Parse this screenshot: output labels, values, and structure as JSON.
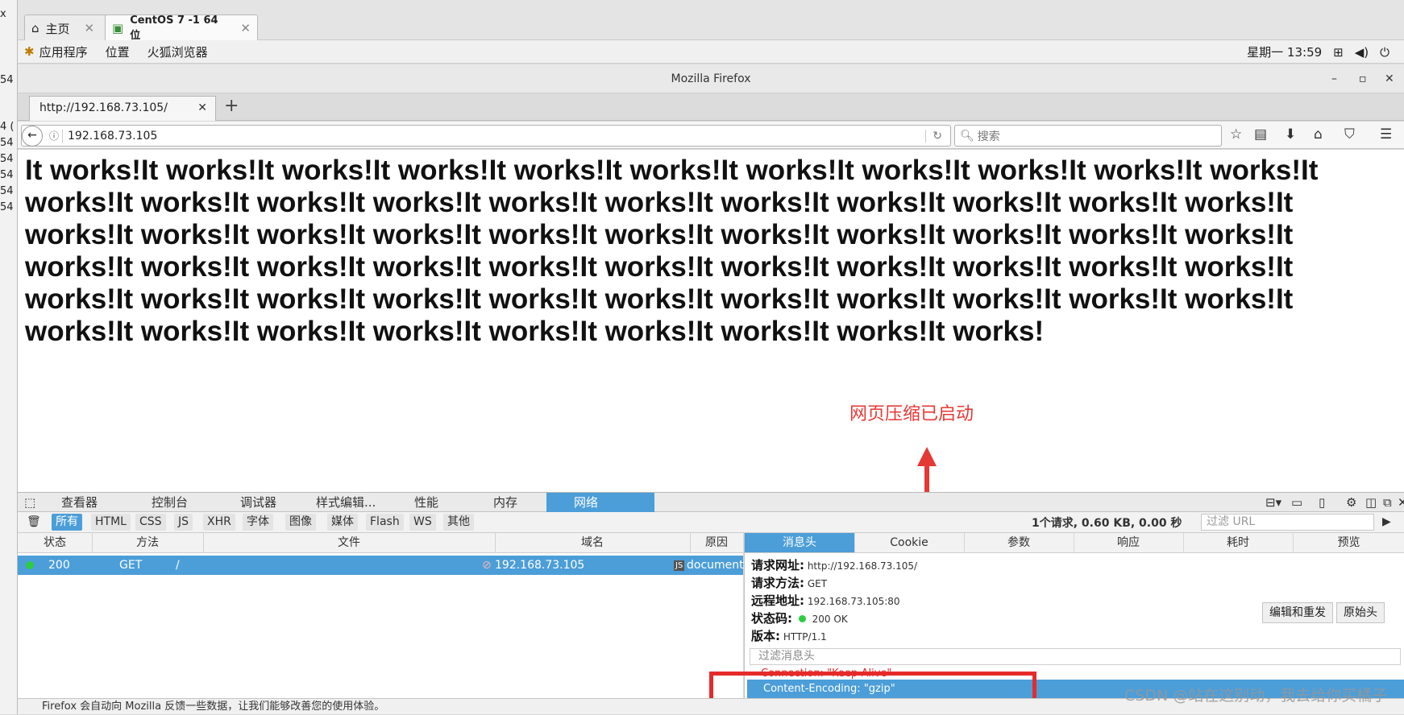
{
  "vm_tabs": [
    {
      "label": "主页",
      "icon": "home-icon"
    },
    {
      "label": "CentOS 7 -1 64 位",
      "icon": "vm-icon"
    }
  ],
  "left_strip": {
    "chars": [
      "x",
      "54",
      "4 (",
      "54",
      "54",
      "54",
      "54",
      "54"
    ]
  },
  "gnome_bar": {
    "menus": [
      "应用程序",
      "位置",
      "火狐浏览器"
    ],
    "clock": "星期一 13:59"
  },
  "window": {
    "title": "Mozilla Firefox"
  },
  "browser_tab": {
    "label": "http://192.168.73.105/"
  },
  "navbar": {
    "url": "192.168.73.105",
    "search_placeholder": "搜索"
  },
  "content": {
    "text": "It works!It works!It works!It works!It works!It works!It works!It works!It works!It works!It works!It works!It works!It works!It works!It works!It works!It works!It works!It works!It works!It works!It works!It works!It works!It works!It works!It works!It works!It works!It works!It works!It works!It works!It works!It works!It works!It works!It works!It works!It works!It works!It works!It works!It works!It works!It works!It works!It works!It works!It works!It works!It works!It works!It works!It works!It works!It works!It works!It works!It works!It works!It works!It works!",
    "annotation": "网页压缩已启动"
  },
  "devtools": {
    "tabs": [
      "查看器",
      "控制台",
      "调试器",
      "样式编辑...",
      "性能",
      "内存",
      "网络"
    ],
    "filters": [
      "所有",
      "HTML",
      "CSS",
      "JS",
      "XHR",
      "字体",
      "图像",
      "媒体",
      "Flash",
      "WS",
      "其他"
    ],
    "summary": "1个请求, 0.60 KB, 0.00 秒",
    "filter_url_placeholder": "过滤 URL",
    "columns": [
      "状态",
      "方法",
      "文件",
      "域名",
      "原因"
    ],
    "request": {
      "status": "200",
      "method": "GET",
      "file": "/",
      "domain": "192.168.73.105",
      "cause": "document",
      "cause_badge": "JS"
    },
    "side_tabs": [
      "消息头",
      "Cookie",
      "参数",
      "响应",
      "耗时",
      "预览"
    ],
    "details": {
      "url_label": "请求网址:",
      "url": "http://192.168.73.105/",
      "method_label": "请求方法:",
      "method": "GET",
      "remote_label": "远程地址:",
      "remote": "192.168.73.105:80",
      "status_label": "状态码:",
      "status": "200  OK",
      "version_label": "版本:",
      "version": "HTTP/1.1"
    },
    "buttons": {
      "edit_resend": "编辑和重发",
      "raw_headers": "原始头"
    },
    "filter_headers_placeholder": "过滤消息头",
    "header_connection": "Connection: \"Keep-Alive\"",
    "header_encoding": "Content-Encoding: \"gzip\""
  },
  "notification": "Firefox 会自动向 Mozilla 反馈一些数据，让我们能够改善您的使用体验。",
  "watermark": "CSDN @站在这别动，我去给你买橘子",
  "colors": {
    "accent": "#4c9ed9",
    "annotation": "#e53935",
    "status_ok": "#2ecc40"
  }
}
